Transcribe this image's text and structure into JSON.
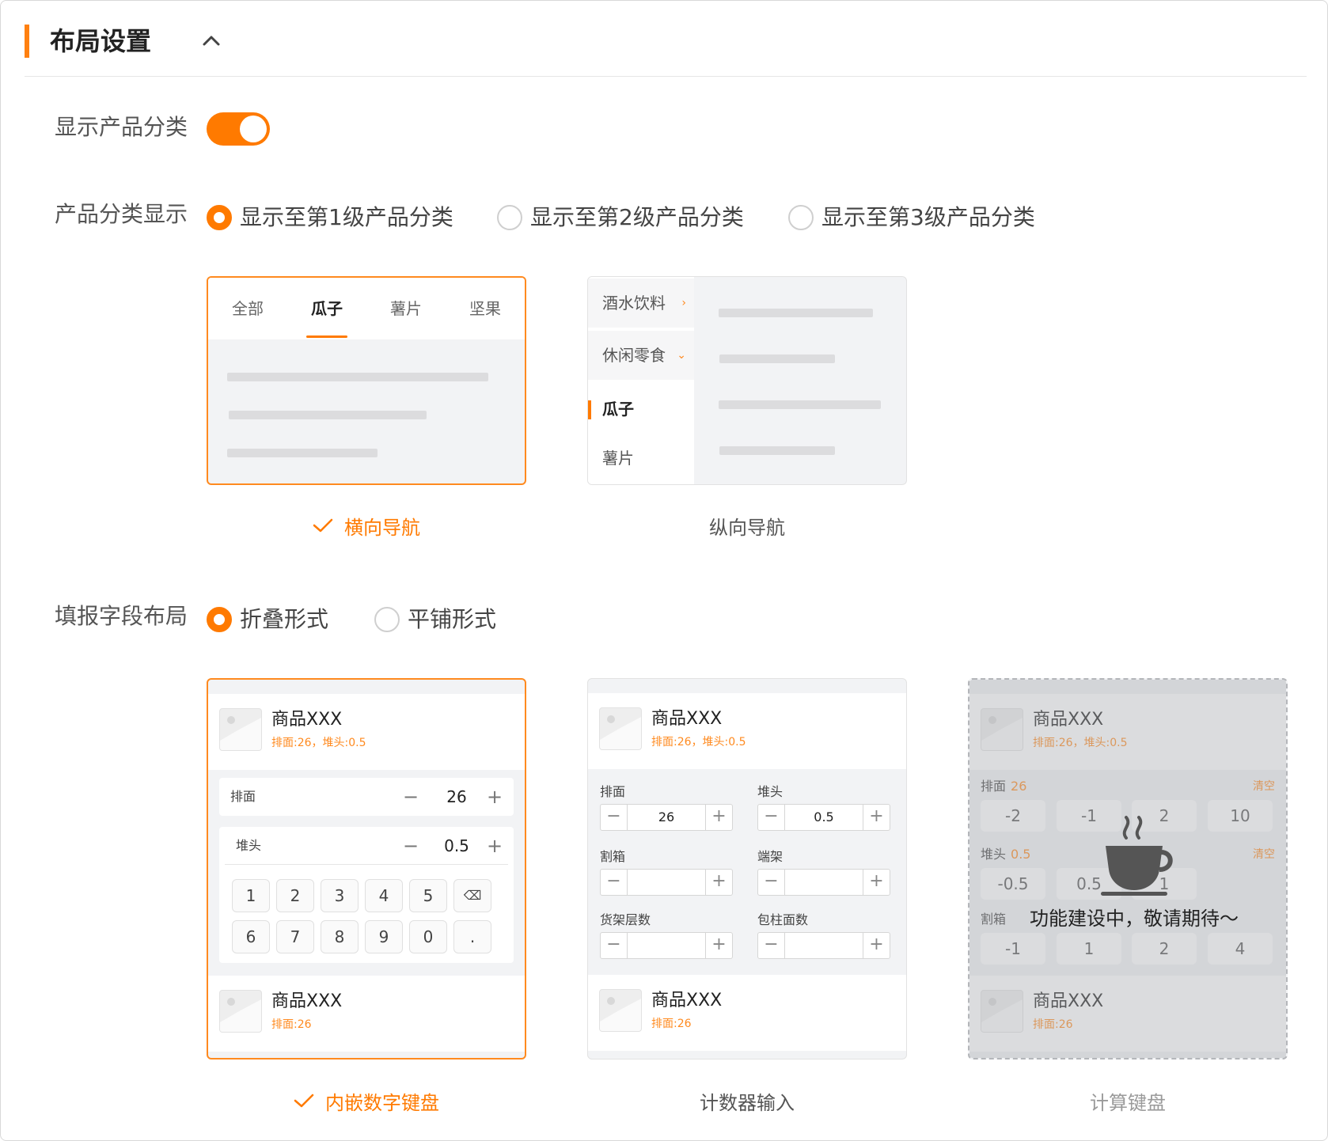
{
  "section": {
    "title": "布局设置"
  },
  "show_category": {
    "label": "显示产品分类",
    "enabled": true
  },
  "category_display": {
    "label": "产品分类显示",
    "options": [
      "显示至第1级产品分类",
      "显示至第2级产品分类",
      "显示至第3级产品分类"
    ],
    "selected_index": 0
  },
  "nav_previews": {
    "horizontal": {
      "caption": "横向导航",
      "selected": true,
      "tabs": [
        "全部",
        "瓜子",
        "薯片",
        "坚果"
      ],
      "active_tab_index": 1
    },
    "vertical": {
      "caption": "纵向导航",
      "selected": false,
      "items": [
        "酒水饮料",
        "休闲零食",
        "瓜子",
        "薯片"
      ],
      "arrows": [
        "›",
        "⌄"
      ],
      "active_item_index": 2
    }
  },
  "field_layout": {
    "label": "填报字段布局",
    "options": [
      "折叠形式",
      "平铺形式"
    ],
    "selected_index": 0
  },
  "input_previews": {
    "numpad": {
      "caption": "内嵌数字键盘",
      "selected": true,
      "product_top": {
        "name": "商品XXX",
        "meta": "排面:26，堆头:0.5"
      },
      "rows": [
        {
          "label": "排面",
          "value": "26"
        },
        {
          "label": "堆头",
          "value": "0.5"
        }
      ],
      "keys": [
        "1",
        "2",
        "3",
        "4",
        "5",
        "⌫",
        "6",
        "7",
        "8",
        "9",
        "0",
        "."
      ],
      "product_bottom": {
        "name": "商品XXX",
        "meta": "排面:26"
      }
    },
    "counter": {
      "caption": "计数器输入",
      "selected": false,
      "product_top": {
        "name": "商品XXX",
        "meta": "排面:26，堆头:0.5"
      },
      "fields": [
        {
          "label": "排面",
          "value": "26"
        },
        {
          "label": "堆头",
          "value": "0.5"
        },
        {
          "label": "割箱",
          "value": ""
        },
        {
          "label": "端架",
          "value": ""
        },
        {
          "label": "货架层数",
          "value": ""
        },
        {
          "label": "包柱面数",
          "value": ""
        }
      ],
      "minus": "−",
      "plus": "+",
      "product_bottom": {
        "name": "商品XXX",
        "meta": "排面:26"
      }
    },
    "calculator": {
      "caption": "计算键盘",
      "disabled": true,
      "product_top": {
        "name": "商品XXX",
        "meta": "排面:26，堆头:0.5"
      },
      "groups": [
        {
          "label": "排面",
          "value": "26",
          "clear": "清空",
          "keys": [
            "-2",
            "-1",
            "2",
            "10"
          ]
        },
        {
          "label": "堆头",
          "value": "0.5",
          "clear": "清空",
          "keys": [
            "-0.5",
            "0.5",
            "1"
          ]
        },
        {
          "label": "割箱",
          "value": "",
          "clear": "",
          "keys": [
            "-1",
            "1",
            "2",
            "4"
          ]
        }
      ],
      "overlay_text": "功能建设中，敬请期待～",
      "overlay_icon": "coffee-cup-icon",
      "product_bottom": {
        "name": "商品XXX",
        "meta": "排面:26"
      }
    }
  },
  "colors": {
    "accent": "#ff7a00",
    "border_selected": "#ff8a1f",
    "skeleton": "#dcdcde"
  }
}
